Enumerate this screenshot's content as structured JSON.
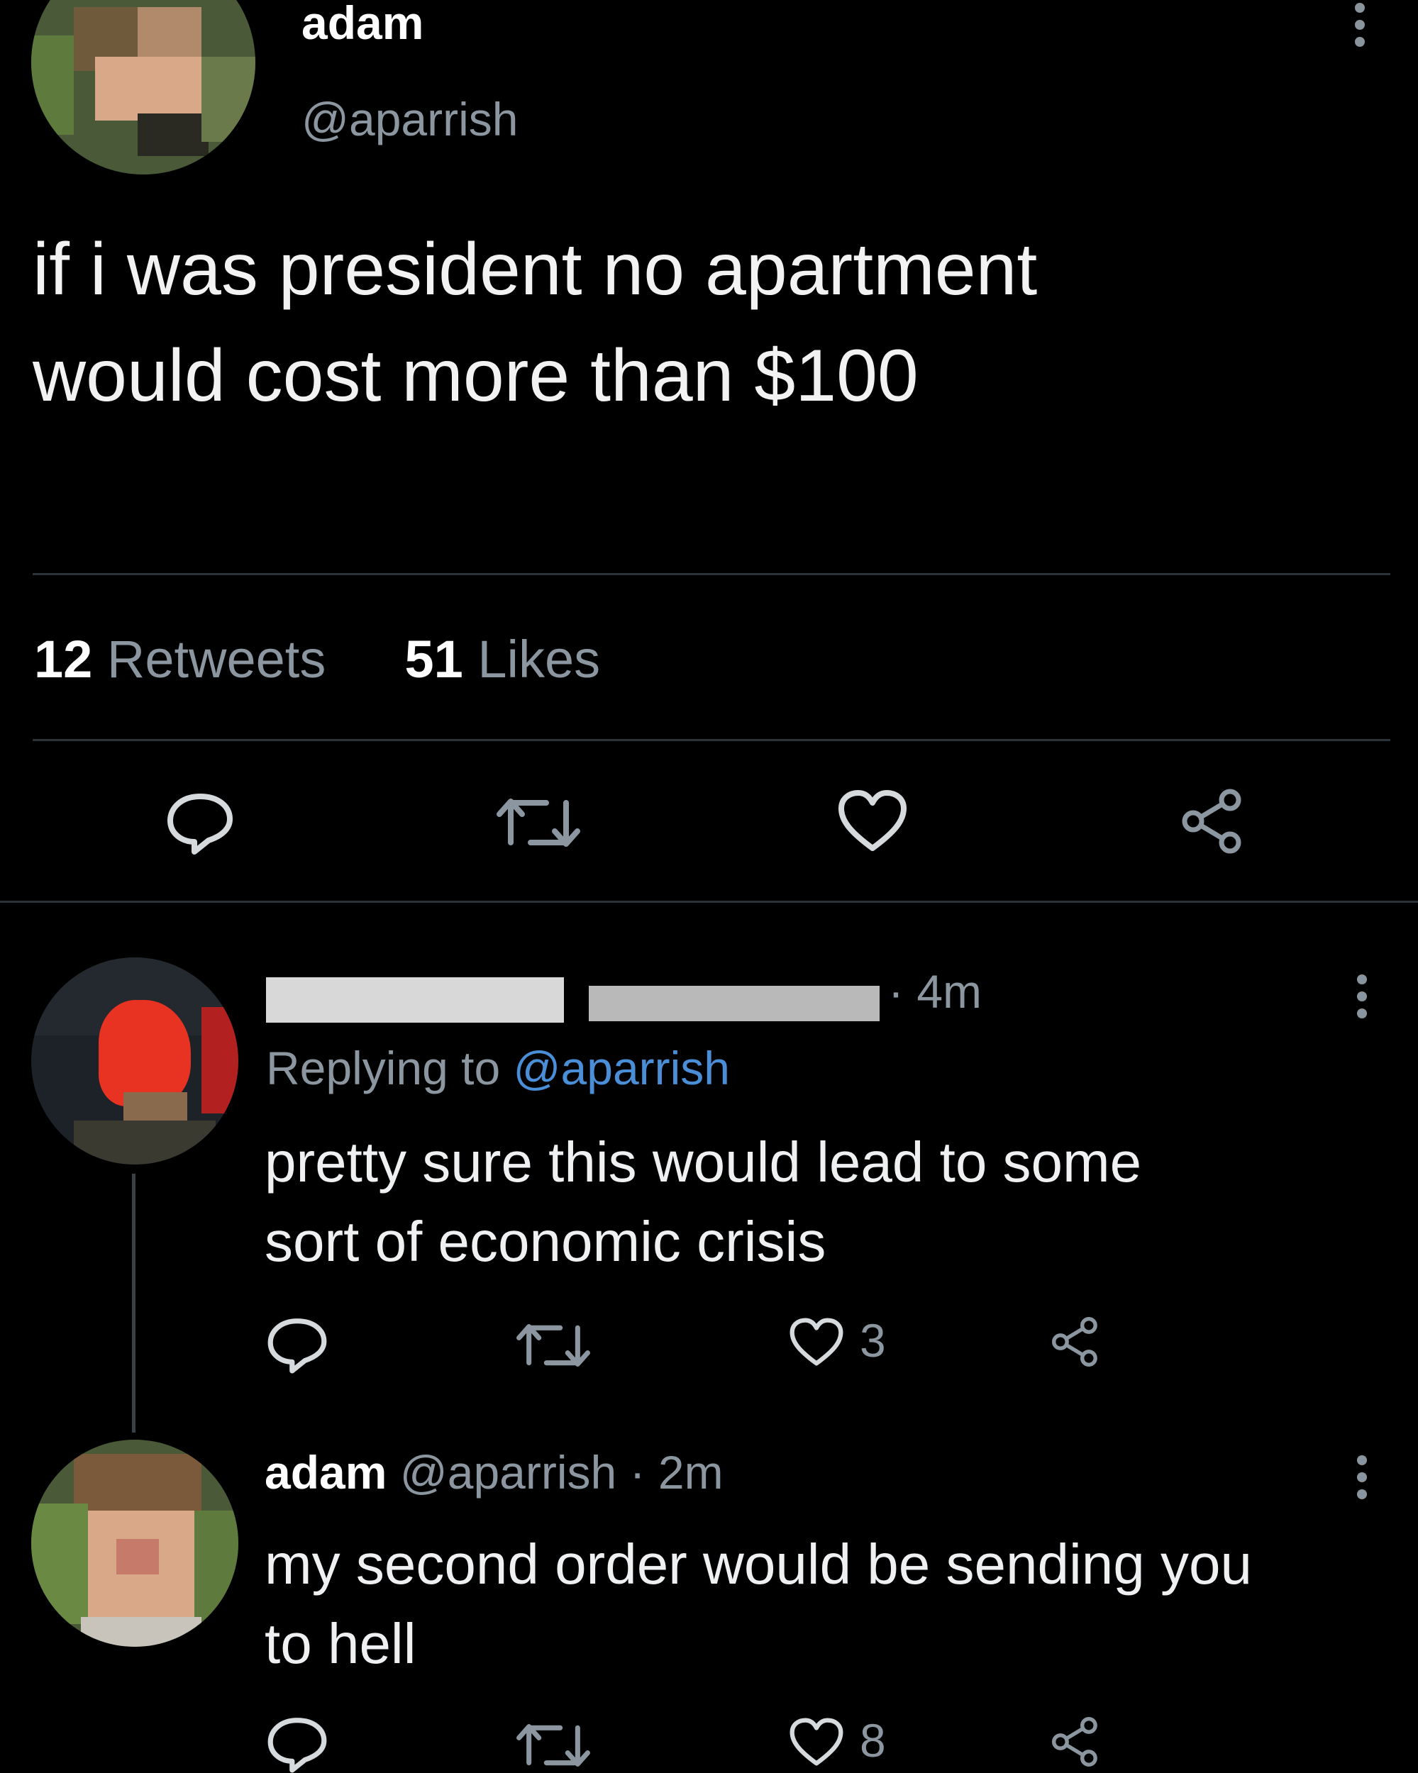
{
  "tweet": {
    "author_name": "adam",
    "author_handle": "@aparrish",
    "text_line1": "if i was president no apartment",
    "text_line2": "would cost more than $100",
    "retweets_count": "12",
    "retweets_label": "Retweets",
    "likes_count": "51",
    "likes_label": "Likes"
  },
  "reply1": {
    "time": "· 4m",
    "replying_prefix": "Replying to",
    "replying_handle": "@aparrish",
    "text_line1": "pretty sure this would lead to some",
    "text_line2": "sort of economic crisis",
    "like_count": "3"
  },
  "reply2": {
    "author_name": "adam",
    "author_handle": "@aparrish",
    "time": "· 2m",
    "text_line1": "my second order would be sending you",
    "text_line2": "to hell",
    "like_count": "8"
  },
  "colors": {
    "background": "#000000",
    "secondary_text": "#8b96a0",
    "mention": "#4a8ed8",
    "divider": "#2b3238"
  },
  "icons": [
    "more-icon",
    "reply-icon",
    "retweet-icon",
    "like-icon",
    "share-icon"
  ]
}
